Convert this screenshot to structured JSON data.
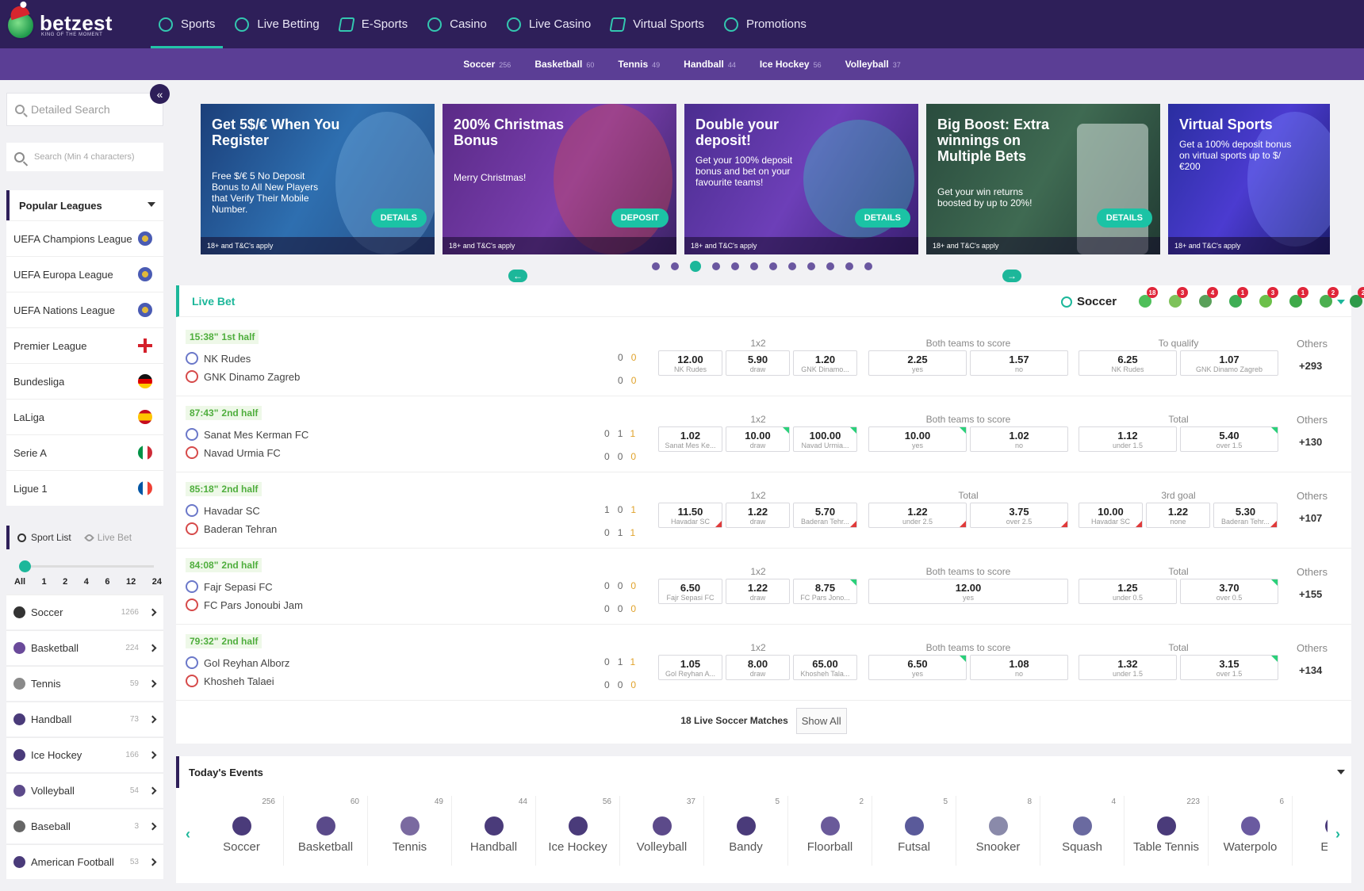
{
  "brand": {
    "name": "betzest",
    "tagline": "KING OF THE MOMENT"
  },
  "nav": [
    "Sports",
    "Live Betting",
    "E-Sports",
    "Casino",
    "Live Casino",
    "Virtual Sports",
    "Promotions"
  ],
  "subnav": [
    {
      "label": "Soccer",
      "count": "256"
    },
    {
      "label": "Basketball",
      "count": "60"
    },
    {
      "label": "Tennis",
      "count": "49"
    },
    {
      "label": "Handball",
      "count": "44"
    },
    {
      "label": "Ice Hockey",
      "count": "56"
    },
    {
      "label": "Volleyball",
      "count": "37"
    }
  ],
  "sidebar": {
    "collapse_icon": "«",
    "detailed_search_placeholder": "Detailed Search",
    "search_placeholder": "Search (Min 4 characters)",
    "popular_title": "Popular Leagues",
    "leagues": [
      {
        "name": "UEFA Champions League",
        "flag": "euro"
      },
      {
        "name": "UEFA Europa League",
        "flag": "euro"
      },
      {
        "name": "UEFA Nations League",
        "flag": "euro"
      },
      {
        "name": "Premier League",
        "flag": "eng"
      },
      {
        "name": "Bundesliga",
        "flag": "ger"
      },
      {
        "name": "LaLiga",
        "flag": "esp"
      },
      {
        "name": "Serie A",
        "flag": "ita"
      },
      {
        "name": "Ligue 1",
        "flag": "fra"
      }
    ],
    "tab_sport_list": "Sport List",
    "tab_live_bet": "Live Bet",
    "time_filters": [
      "All",
      "1",
      "2",
      "4",
      "6",
      "12",
      "24"
    ],
    "sports": [
      {
        "name": "Soccer",
        "count": "1266"
      },
      {
        "name": "Basketball",
        "count": "224"
      },
      {
        "name": "Tennis",
        "count": "59"
      },
      {
        "name": "Handball",
        "count": "73"
      },
      {
        "name": "Ice Hockey",
        "count": "166"
      },
      {
        "name": "Volleyball",
        "count": "54"
      },
      {
        "name": "Baseball",
        "count": "3"
      },
      {
        "name": "American Football",
        "count": "53"
      }
    ]
  },
  "banners": [
    {
      "title": "Get 5$/€ When You Register",
      "text": "Free $/€ 5 No Deposit Bonus to All New Players that Verify Their Mobile Number.",
      "cta": "DETAILS",
      "foot": "18+ and T&C's apply"
    },
    {
      "title": "200% Christmas Bonus",
      "text": "Merry Christmas!",
      "cta": "DEPOSIT",
      "foot": "18+ and T&C's apply"
    },
    {
      "title": "Double your deposit!",
      "text": "Get your 100% deposit bonus and bet on your favourite teams!",
      "cta": "DETAILS",
      "foot": "18+ and T&C's apply"
    },
    {
      "title": "Big Boost: Extra winnings on Multiple Bets",
      "text": "Get your win returns boosted by up to 20%!",
      "cta": "DETAILS",
      "foot": "18+ and T&C's apply"
    },
    {
      "title": "Virtual Sports",
      "text": "Get a 100% deposit bonus on virtual sports up to $/€200",
      "cta": "",
      "foot": "18+ and T&C's apply"
    }
  ],
  "carousel": {
    "dot_count": 12,
    "active_index": 2,
    "prev": "←",
    "next": "→"
  },
  "live": {
    "title": "Live Bet",
    "sport": "Soccer",
    "sport_badges": [
      "18",
      "3",
      "4",
      "1",
      "3",
      "1",
      "2",
      "2"
    ],
    "others_label": "Others",
    "matches": [
      {
        "time": "15:38\"",
        "half": "1st half",
        "home": "NK Rudes",
        "away": "GNK Dinamo Zagreb",
        "home_score": [
          "0",
          "0"
        ],
        "away_score": [
          "0",
          "0"
        ],
        "g1": "1x2",
        "o1": [
          {
            "v": "12.00",
            "l": "NK Rudes"
          },
          {
            "v": "5.90",
            "l": "draw"
          },
          {
            "v": "1.20",
            "l": "GNK Dinamo..."
          }
        ],
        "g2": "Both teams to score",
        "o2": [
          {
            "v": "2.25",
            "l": "yes"
          },
          {
            "v": "1.57",
            "l": "no"
          }
        ],
        "g3": "To qualify",
        "o3": [
          {
            "v": "6.25",
            "l": "NK Rudes"
          },
          {
            "v": "1.07",
            "l": "GNK Dinamo Zagreb"
          }
        ],
        "others": "+293"
      },
      {
        "time": "87:43\"",
        "half": "2nd half",
        "home": "Sanat Mes Kerman FC",
        "away": "Navad Urmia FC",
        "home_score": [
          "0",
          "1",
          "1"
        ],
        "away_score": [
          "0",
          "0",
          "0"
        ],
        "g1": "1x2",
        "o1": [
          {
            "v": "1.02",
            "l": "Sanat Mes Ke..."
          },
          {
            "v": "10.00",
            "l": "draw",
            "t": "up"
          },
          {
            "v": "100.00",
            "l": "Navad Urmia...",
            "t": "up"
          }
        ],
        "g2": "Both teams to score",
        "o2": [
          {
            "v": "10.00",
            "l": "yes",
            "t": "up"
          },
          {
            "v": "1.02",
            "l": "no"
          }
        ],
        "g3": "Total",
        "o3": [
          {
            "v": "1.12",
            "l": "under 1.5"
          },
          {
            "v": "5.40",
            "l": "over 1.5",
            "t": "up"
          }
        ],
        "others": "+130"
      },
      {
        "time": "85:18\"",
        "half": "2nd half",
        "home": "Havadar SC",
        "away": "Baderan Tehran",
        "home_score": [
          "1",
          "0",
          "1"
        ],
        "away_score": [
          "0",
          "1",
          "1"
        ],
        "g1": "1x2",
        "o1": [
          {
            "v": "11.50",
            "l": "Havadar SC",
            "t": "down"
          },
          {
            "v": "1.22",
            "l": "draw"
          },
          {
            "v": "5.70",
            "l": "Baderan Tehr...",
            "t": "down"
          }
        ],
        "g2": "Total",
        "o2": [
          {
            "v": "1.22",
            "l": "under 2.5",
            "t": "down"
          },
          {
            "v": "3.75",
            "l": "over 2.5",
            "t": "down"
          }
        ],
        "g3": "3rd goal",
        "o3": [
          {
            "v": "10.00",
            "l": "Havadar SC",
            "t": "down"
          },
          {
            "v": "1.22",
            "l": "none"
          },
          {
            "v": "5.30",
            "l": "Baderan Tehr...",
            "t": "down"
          }
        ],
        "others": "+107"
      },
      {
        "time": "84:08\"",
        "half": "2nd half",
        "home": "Fajr Sepasi FC",
        "away": "FC Pars Jonoubi Jam",
        "home_score": [
          "0",
          "0",
          "0"
        ],
        "away_score": [
          "0",
          "0",
          "0"
        ],
        "g1": "1x2",
        "o1": [
          {
            "v": "6.50",
            "l": "Fajr Sepasi FC"
          },
          {
            "v": "1.22",
            "l": "draw"
          },
          {
            "v": "8.75",
            "l": "FC Pars Jono...",
            "t": "up"
          }
        ],
        "g2": "Both teams to score",
        "o2": [
          {
            "v": "12.00",
            "l": "yes"
          }
        ],
        "g3": "Total",
        "o3": [
          {
            "v": "1.25",
            "l": "under 0.5"
          },
          {
            "v": "3.70",
            "l": "over 0.5",
            "t": "up"
          }
        ],
        "others": "+155"
      },
      {
        "time": "79:32\"",
        "half": "2nd half",
        "home": "Gol Reyhan Alborz",
        "away": "Khosheh Talaei",
        "home_score": [
          "0",
          "1",
          "1"
        ],
        "away_score": [
          "0",
          "0",
          "0"
        ],
        "g1": "1x2",
        "o1": [
          {
            "v": "1.05",
            "l": "Gol Reyhan A..."
          },
          {
            "v": "8.00",
            "l": "draw"
          },
          {
            "v": "65.00",
            "l": "Khosheh Tala..."
          }
        ],
        "g2": "Both teams to score",
        "o2": [
          {
            "v": "6.50",
            "l": "yes",
            "t": "up"
          },
          {
            "v": "1.08",
            "l": "no"
          }
        ],
        "g3": "Total",
        "o3": [
          {
            "v": "1.32",
            "l": "under 1.5"
          },
          {
            "v": "3.15",
            "l": "over 1.5",
            "t": "up"
          }
        ],
        "others": "+134"
      }
    ],
    "footer_text": "18 Live Soccer Matches",
    "show_all": "Show All"
  },
  "today": {
    "title": "Today's Events",
    "prev": "‹",
    "next": "›",
    "events": [
      {
        "name": "Soccer",
        "count": "256"
      },
      {
        "name": "Basketball",
        "count": "60"
      },
      {
        "name": "Tennis",
        "count": "49"
      },
      {
        "name": "Handball",
        "count": "44"
      },
      {
        "name": "Ice Hockey",
        "count": "56"
      },
      {
        "name": "Volleyball",
        "count": "37"
      },
      {
        "name": "Bandy",
        "count": "5"
      },
      {
        "name": "Floorball",
        "count": "2"
      },
      {
        "name": "Futsal",
        "count": "5"
      },
      {
        "name": "Snooker",
        "count": "8"
      },
      {
        "name": "Squash",
        "count": "4"
      },
      {
        "name": "Table Tennis",
        "count": "223"
      },
      {
        "name": "Waterpolo",
        "count": "6"
      },
      {
        "name": "Espo",
        "count": ""
      }
    ]
  }
}
